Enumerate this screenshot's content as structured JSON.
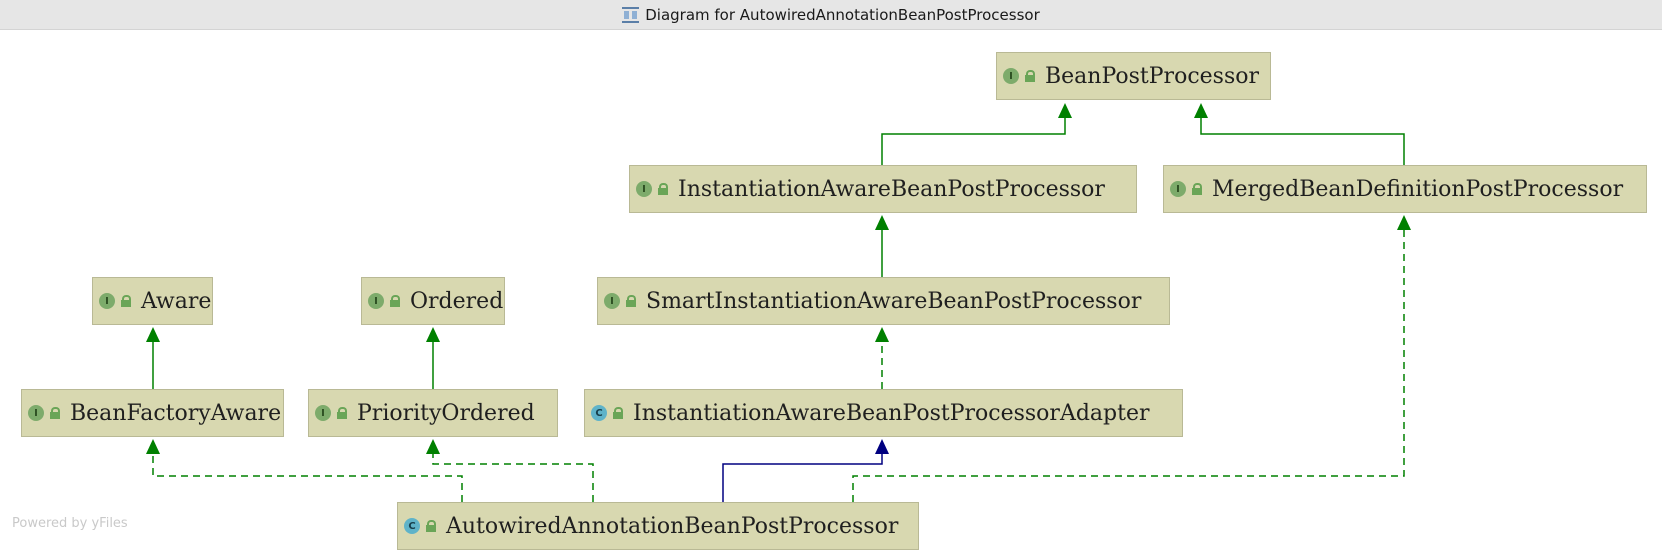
{
  "window": {
    "title": "Diagram for AutowiredAnnotationBeanPostProcessor",
    "icon": "diagram-icon"
  },
  "colors": {
    "node_fill": "#d8d8b0",
    "extends_edge": "#008000",
    "implements_edge": "#008000",
    "class_extends_edge": "#000080",
    "interface_badge": "#7dab6b",
    "class_badge": "#5fb3c9"
  },
  "nodes": [
    {
      "id": "bpp",
      "name": "BeanPostProcessor",
      "kind": "interface",
      "badge": "I"
    },
    {
      "id": "iabpp",
      "name": "InstantiationAwareBeanPostProcessor",
      "kind": "interface",
      "badge": "I"
    },
    {
      "id": "mbdpp",
      "name": "MergedBeanDefinitionPostProcessor",
      "kind": "interface",
      "badge": "I"
    },
    {
      "id": "aware",
      "name": "Aware",
      "kind": "interface",
      "badge": "I"
    },
    {
      "id": "ordered",
      "name": "Ordered",
      "kind": "interface",
      "badge": "I"
    },
    {
      "id": "siabpp",
      "name": "SmartInstantiationAwareBeanPostProcessor",
      "kind": "interface",
      "badge": "I"
    },
    {
      "id": "bfa",
      "name": "BeanFactoryAware",
      "kind": "interface",
      "badge": "I"
    },
    {
      "id": "po",
      "name": "PriorityOrdered",
      "kind": "interface",
      "badge": "I"
    },
    {
      "id": "iabppa",
      "name": "InstantiationAwareBeanPostProcessorAdapter",
      "kind": "class",
      "badge": "C"
    },
    {
      "id": "aabpp",
      "name": "AutowiredAnnotationBeanPostProcessor",
      "kind": "class",
      "badge": "C"
    }
  ],
  "edges": [
    {
      "from": "iabpp",
      "to": "bpp",
      "type": "extends"
    },
    {
      "from": "mbdpp",
      "to": "bpp",
      "type": "extends"
    },
    {
      "from": "siabpp",
      "to": "iabpp",
      "type": "extends"
    },
    {
      "from": "bfa",
      "to": "aware",
      "type": "extends"
    },
    {
      "from": "po",
      "to": "ordered",
      "type": "extends"
    },
    {
      "from": "iabppa",
      "to": "siabpp",
      "type": "implements"
    },
    {
      "from": "aabpp",
      "to": "iabppa",
      "type": "class-extends"
    },
    {
      "from": "aabpp",
      "to": "bfa",
      "type": "implements"
    },
    {
      "from": "aabpp",
      "to": "po",
      "type": "implements"
    },
    {
      "from": "aabpp",
      "to": "mbdpp",
      "type": "implements"
    }
  ],
  "footer": {
    "powered_by": "Powered by yFiles"
  }
}
